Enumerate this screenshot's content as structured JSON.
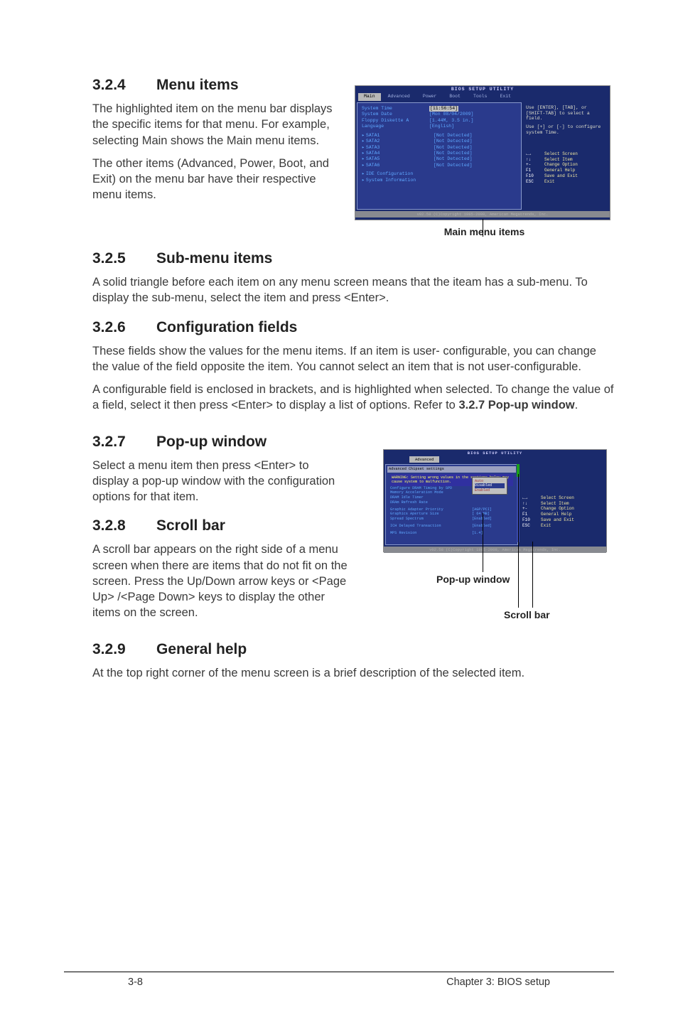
{
  "sections": {
    "s324": {
      "num": "3.2.4",
      "title": "Menu items",
      "p1": "The highlighted item on the menu bar displays the specific items for that menu. For example, selecting Main shows the Main menu items.",
      "p2": "The other items (Advanced, Power, Boot, and Exit) on the menu bar have their respective menu items."
    },
    "s325": {
      "num": "3.2.5",
      "title": "Sub-menu items",
      "p1": "A solid triangle before each item on any menu screen means that the iteam has a sub-menu. To display the sub-menu, select the item and press <Enter>."
    },
    "s326": {
      "num": "3.2.6",
      "title": "Configuration fields",
      "p1": "These fields show the values for the menu items. If an item is user- configurable, you can change the value of the field opposite the item. You cannot select an item that is not user-configurable.",
      "p2a": "A configurable field is enclosed in brackets, and is highlighted when selected. To change the value of a field, select it then press <Enter> to display a list of options. Refer to ",
      "p2b": "3.2.7 Pop-up window",
      "p2c": "."
    },
    "s327": {
      "num": "3.2.7",
      "title": "Pop-up window",
      "p1": "Select a menu item then press <Enter> to display a pop-up window with the configuration options for that item."
    },
    "s328": {
      "num": "3.2.8",
      "title": "Scroll bar",
      "p1": "A scroll bar appears on the right side of a menu screen when there are items that do not fit on the screen. Press the Up/Down arrow keys or <Page Up> /<Page Down> keys to display the other items on the screen."
    },
    "s329": {
      "num": "3.2.9",
      "title": "General help",
      "p1": "At the top right corner of the menu screen is a brief description of the selected item."
    }
  },
  "captions": {
    "fig1": "Main menu items",
    "fig2_popup": "Pop-up window",
    "fig2_scroll": "Scroll bar"
  },
  "bios1": {
    "title": "BIOS SETUP UTILITY",
    "tabs": [
      "Main",
      "Advanced",
      "Power",
      "Boot",
      "Tools",
      "Exit"
    ],
    "rows": [
      {
        "lbl": "System Time",
        "val": "[11:56:54]",
        "hl": true
      },
      {
        "lbl": "System Date",
        "val": "[Mon 08/04/2009]"
      },
      {
        "lbl": "Floppy Diskette A",
        "val": "[1.44M, 3.5 in.]"
      },
      {
        "lbl": "Language",
        "val": "[English]"
      }
    ],
    "sata": [
      "SATA1",
      "SATA2",
      "SATA3",
      "SATA4",
      "SATA5",
      "SATA6"
    ],
    "sata_val": "[Not Detected]",
    "subs": [
      "IDE Configuration",
      "System Information"
    ],
    "help1": "Use [ENTER], [TAB], or [SHIFT-TAB] to select a field.",
    "help2": "Use [+] or [-] to configure system Time.",
    "keys": [
      {
        "k": "←→",
        "d": "Select Screen"
      },
      {
        "k": "↑↓",
        "d": "Select Item"
      },
      {
        "k": "+-",
        "d": "Change Option"
      },
      {
        "k": "F1",
        "d": "General Help"
      },
      {
        "k": "F10",
        "d": "Save and Exit"
      },
      {
        "k": "ESC",
        "d": "Exit"
      }
    ],
    "foot": "v02.58 (C)Copyright 1985-2008, American Megatrends, Inc."
  },
  "bios2": {
    "title": "BIOS SETUP UTILITY",
    "tab": "Advanced",
    "header": "Advanced Chipset settings",
    "warn": "WARNING: Setting wrong values in the sections below may cause system to malfunction.",
    "rows": [
      {
        "lbl": "Configure DRAM Timing by SPD",
        "val": "[Enabled]"
      },
      {
        "lbl": "Memory Acceleration Mode",
        "val": "[Auto]"
      },
      {
        "lbl": "DRAM Idle Timer",
        "val": ""
      },
      {
        "lbl": "DRAm Refresh Rate",
        "val": ""
      },
      {
        "lbl": "Graphic Adapter Priority",
        "val": "[AGP/PCI]"
      },
      {
        "lbl": "Graphics Aperture Size",
        "val": "[ 64 MB]"
      },
      {
        "lbl": "Spread Spectrum",
        "val": "[Enabled]"
      },
      {
        "lbl": "ICH Delayed Transaction",
        "val": "[Enabled]"
      },
      {
        "lbl": "MPS Revision",
        "val": "[1.4]"
      }
    ],
    "popup": [
      "Auto",
      "Disabled",
      "Enabled"
    ],
    "keys": [
      {
        "k": "←→",
        "d": "Select Screen"
      },
      {
        "k": "↑↓",
        "d": "Select Item"
      },
      {
        "k": "+-",
        "d": "Change Option"
      },
      {
        "k": "F1",
        "d": "General Help"
      },
      {
        "k": "F10",
        "d": "Save and Exit"
      },
      {
        "k": "ESC",
        "d": "Exit"
      }
    ],
    "foot": "v02.58 (C)Copyright 1985-2008, American Megatrends, Inc."
  },
  "footer": {
    "left": "3-8",
    "right": "Chapter 3: BIOS setup"
  }
}
